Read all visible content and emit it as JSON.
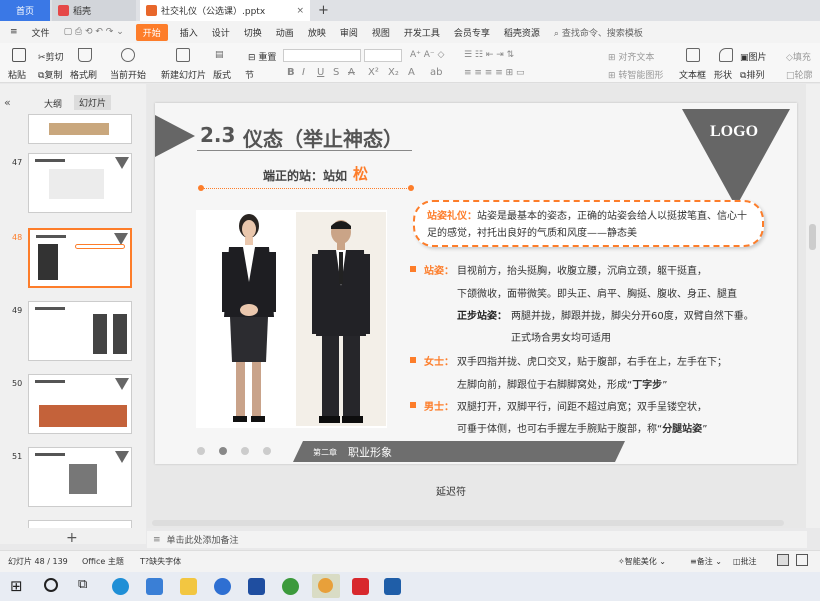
{
  "tabs": {
    "home": "首页",
    "daoke": "稻壳",
    "doc": "社交礼仪（公选课）.pptx"
  },
  "menu": [
    "文件",
    "开始",
    "插入",
    "设计",
    "切换",
    "动画",
    "放映",
    "审阅",
    "视图",
    "开发工具",
    "会员专享",
    "稻壳资源"
  ],
  "search_placeholder": "查找命令、搜索模板",
  "ribbon": {
    "cut": "剪切",
    "copy": "复制",
    "paste": "粘贴",
    "format_painter": "格式刷",
    "play_from": "当前开始",
    "new_slide": "新建幻灯片",
    "layout": "版式",
    "section": "节",
    "reset": "重置",
    "align_text": "对齐文本",
    "smart_art": "转智能图形",
    "textbox": "文本框",
    "shape": "形状",
    "arrange": "排列",
    "picture": "图片",
    "fill": "填充",
    "outline": "轮廓"
  },
  "panel_tabs": {
    "outline": "大纲",
    "slides": "幻灯片"
  },
  "thumbnails": [
    {
      "num": "47"
    },
    {
      "num": "48"
    },
    {
      "num": "49"
    },
    {
      "num": "50"
    },
    {
      "num": "51"
    }
  ],
  "slide": {
    "heading_num": "2.3",
    "heading": "仪态（举止神态）",
    "logo": "LOGO",
    "subtitle_prefix": "端正的站：站如",
    "subtitle_accent": "松",
    "callout_label": "站姿礼仪：",
    "callout_text": "站姿是最基本的姿态，正确的站姿会给人以挺拔笔直、信心十足的感觉，衬托出良好的气质和风度——静态美",
    "b1_label": "站姿：",
    "b1_l1": "目视前方，抬头挺胸，收腹立腰，沉肩立颈，躯干挺直，",
    "b1_l2": "下颌微收，面带微笑。即头正、肩平、胸挺、腹收、身正、腿直",
    "b1_bold": "正步站姿：",
    "b1_l3": "两腿并拢，脚跟并拢，脚尖分开60度，双臂自然下垂。",
    "b1_l4": "正式场合男女均可适用",
    "b2_label": "女士：",
    "b2_l1": "双手四指并拢、虎口交叉，贴于腹部，右手在上，左手在下；",
    "b2_l2": "左脚向前，脚跟位于右脚脚窝处，形成“",
    "b2_bold": "丁字步",
    "b2_end": "”",
    "b3_label": "男士：",
    "b3_l1": "双腿打开，双脚平行，间距不超过肩宽；双手呈镂空状，",
    "b3_l2": "可垂于体侧，也可右手握左手腕贴于腹部，称“",
    "b3_bold": "分腿站姿",
    "b3_end": "”",
    "chapter_small": "第二章",
    "chapter": "职业形象"
  },
  "below_slide": "延迟符",
  "notes": "单击此处添加备注",
  "status": {
    "slide": "幻灯片 48 / 139",
    "theme": "Office 主题",
    "missing_font": "缺失字体",
    "beautify": "智能美化",
    "notes": "备注",
    "comment": "批注"
  },
  "colors": {
    "accent": "#fd7d2a",
    "dark": "#555555",
    "home_tab": "#3a78e6"
  }
}
